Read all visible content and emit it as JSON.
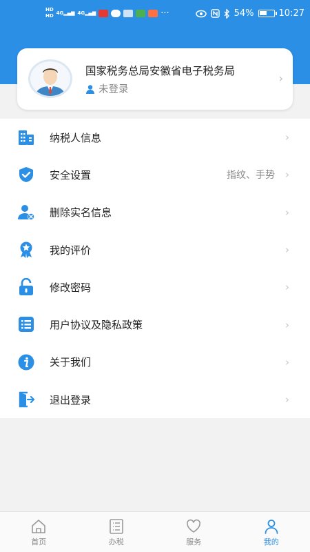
{
  "status_bar": {
    "hd_top": "HD",
    "hd_bottom": "HD",
    "net1": "4G",
    "net2": "4G",
    "more": "···",
    "battery_percent": "54%",
    "battery_level": 0.54,
    "time": "10:27"
  },
  "profile": {
    "org_name": "国家税务总局安徽省电子税务局",
    "login_status": "未登录",
    "chevron": "›"
  },
  "menu": [
    {
      "label": "纳税人信息",
      "value": "",
      "icon": "building-icon"
    },
    {
      "label": "安全设置",
      "value": "指纹、手势",
      "icon": "shield-check-icon"
    },
    {
      "label": "删除实名信息",
      "value": "",
      "icon": "user-remove-icon"
    },
    {
      "label": "我的评价",
      "value": "",
      "icon": "award-icon"
    },
    {
      "label": "修改密码",
      "value": "",
      "icon": "lock-open-icon"
    },
    {
      "label": "用户协议及隐私政策",
      "value": "",
      "icon": "list-icon"
    },
    {
      "label": "关于我们",
      "value": "",
      "icon": "info-icon"
    },
    {
      "label": "退出登录",
      "value": "",
      "icon": "logout-icon"
    }
  ],
  "menu_chevron": "›",
  "tabs": [
    {
      "label": "首页",
      "icon": "home-icon",
      "active": false
    },
    {
      "label": "办税",
      "icon": "document-list-icon",
      "active": false
    },
    {
      "label": "服务",
      "icon": "heart-icon",
      "active": false
    },
    {
      "label": "我的",
      "icon": "person-icon",
      "active": true
    }
  ],
  "colors": {
    "primary": "#2b8fe6",
    "background": "#f2f2f2",
    "text": "#222222",
    "muted": "#888888"
  }
}
